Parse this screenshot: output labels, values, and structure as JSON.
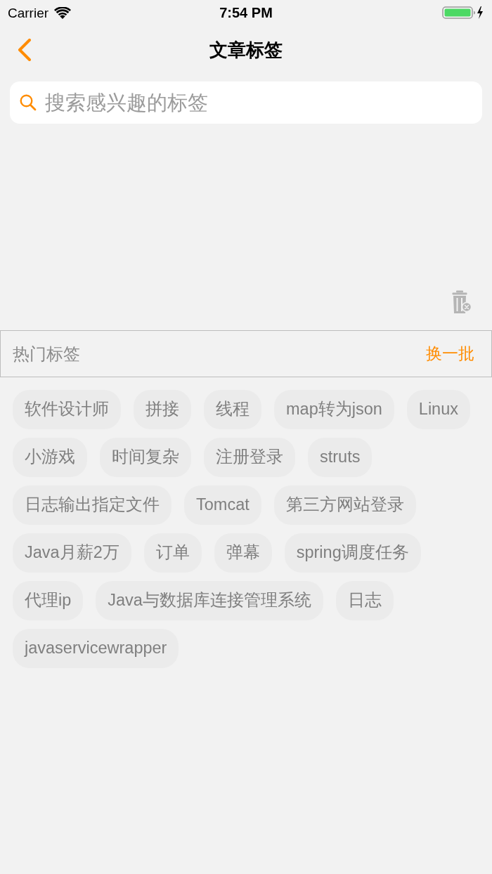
{
  "status_bar": {
    "carrier": "Carrier",
    "time": "7:54 PM"
  },
  "nav_bar": {
    "title": "文章标签"
  },
  "search": {
    "placeholder": "搜索感兴趣的标签"
  },
  "hot_tags": {
    "title": "热门标签",
    "refresh": "换一批",
    "tags": [
      "软件设计师",
      "拼接",
      "线程",
      "map转为json",
      "Linux",
      "小游戏",
      "时间复杂",
      "注册登录",
      "struts",
      "日志输出指定文件",
      "Tomcat",
      "第三方网站登录",
      "Java月薪2万",
      "订单",
      "弹幕",
      "spring调度任务",
      "代理ip",
      "Java与数据库连接管理系统",
      "日志",
      "javaservicewrapper"
    ]
  }
}
